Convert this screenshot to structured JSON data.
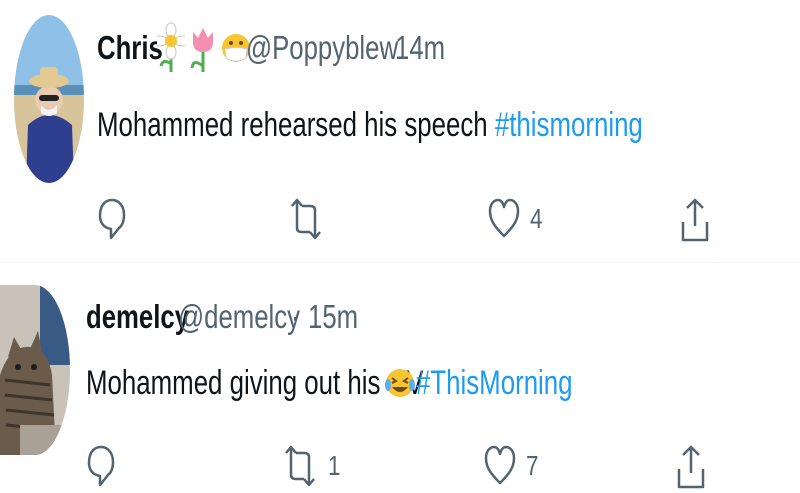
{
  "tweets": [
    {
      "name": "Chris",
      "handle": "@Poppyblew",
      "time": "14m",
      "text": "Mohammed rehearsed his speech",
      "hashtag": "#thismorning",
      "likes": "4"
    },
    {
      "name": "demelcy",
      "handle": "@demelcy",
      "time": "15m",
      "text": "Mohammed giving out his CV",
      "hashtag": "#ThisMorning",
      "retweets": "1",
      "likes": "7"
    }
  ],
  "separator": "·",
  "colors": {
    "hashtag": "#1d9bf0",
    "meta": "#536471",
    "text": "#0f1419"
  },
  "icons": [
    "reply-icon",
    "retweet-icon",
    "like-icon",
    "share-icon",
    "daisy-emoji",
    "tulip-emoji",
    "mask-emoji",
    "laughing-emoji"
  ]
}
